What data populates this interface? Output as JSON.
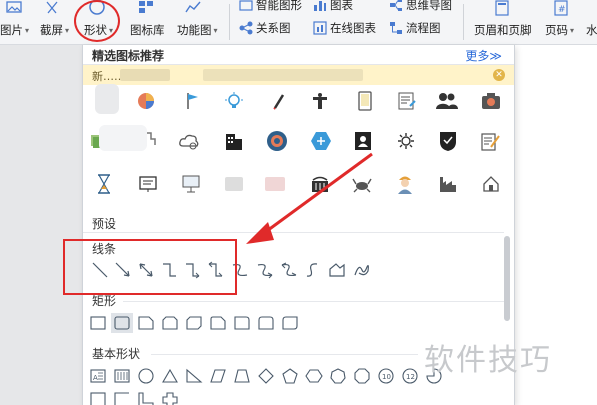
{
  "ribbon": {
    "picture_label": "图片",
    "screenshot_label": "截屏",
    "shape_label": "形状",
    "icon_library_label": "图标库",
    "function_label": "功能图",
    "smart_shape_label": "智能图形",
    "relation_label": "关系图",
    "chart_label": "图表",
    "online_chart_label": "在线图表",
    "mindmap_label": "思维导图",
    "flowchart_label": "流程图",
    "header_footer_label": "页眉和页脚",
    "page_number_label": "页码",
    "cut_label": "水"
  },
  "panel": {
    "recommend_title": "精选图标推荐",
    "more_label": "更多≫",
    "banner_text": "新……",
    "preset_label": "预设",
    "lines_label": "线条",
    "rect_label": "矩形",
    "basic_label": "基本形状"
  },
  "icons": [
    "blurred",
    "pie-chart-icon",
    "flag-icon",
    "lightbulb-icon",
    "pen-icon",
    "podium-icon",
    "phone-icon",
    "contract-icon",
    "team-icon",
    "camera-icon",
    "money-icon",
    "puzzle-icon",
    "cloud-icon",
    "building-icon",
    "target-icon",
    "hexagon-icon",
    "contact-icon",
    "gear-icon",
    "shield-icon",
    "edit-icon",
    "hourglass-icon",
    "board-icon",
    "presentation-icon",
    "blurred",
    "blurred",
    "basket-icon",
    "crab-icon",
    "worker-icon",
    "factory-icon",
    "house-icon"
  ],
  "watermark": "软件技巧",
  "colors": {
    "accent": "#2a6ad9",
    "annotation": "#e02a2a",
    "banner": "#fff3c9"
  }
}
